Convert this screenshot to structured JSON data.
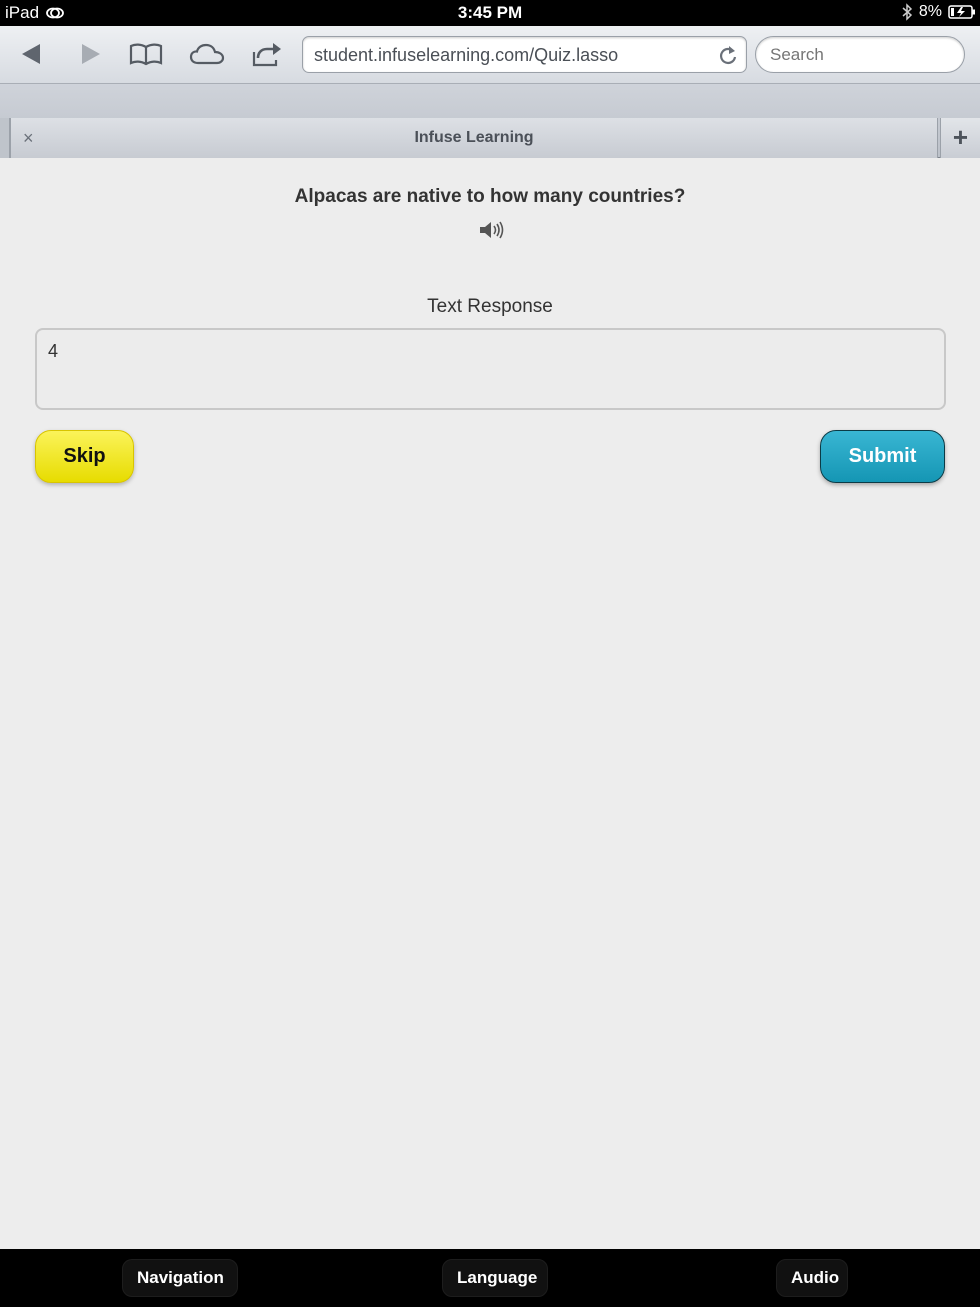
{
  "status_bar": {
    "device": "iPad",
    "time": "3:45 PM",
    "battery": "8%"
  },
  "browser": {
    "url": "student.infuselearning.com/Quiz.lasso",
    "search_placeholder": "Search",
    "tab_title": "Infuse Learning",
    "tab_close": "×",
    "new_tab": "+"
  },
  "quiz": {
    "question": "Alpacas are native to how many countries?",
    "response_label": "Text Response",
    "answer_value": "4",
    "skip_label": "Skip",
    "submit_label": "Submit",
    "colors": {
      "skip": "#f2ea2a",
      "submit": "#22a6c4"
    }
  },
  "bottom_bar": {
    "navigation_label": "Navigation",
    "language_label": "Language",
    "audio_label": "Audio"
  }
}
